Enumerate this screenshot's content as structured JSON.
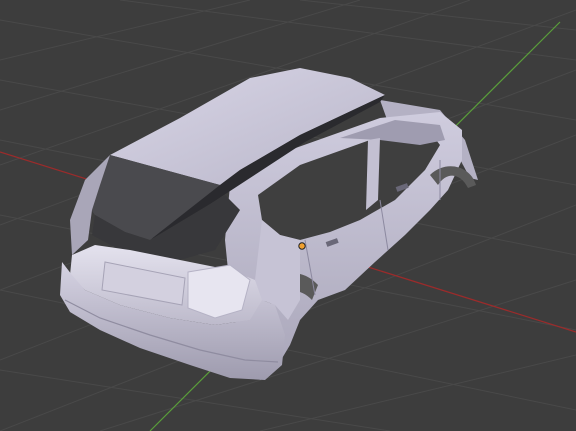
{
  "viewport": {
    "view": "3D Viewport",
    "shading": "solid",
    "background_color": "#3d3d3d",
    "grid_color": "#4a4a4a",
    "x_axis_color": "#9b2b2b",
    "y_axis_color": "#5a9e3a",
    "selected_object_origin_color": "#f0a030"
  },
  "scene": {
    "object_name": "",
    "object_kind": "car body shell mesh (hatchback)",
    "mesh_color": "#c9c6d8"
  }
}
